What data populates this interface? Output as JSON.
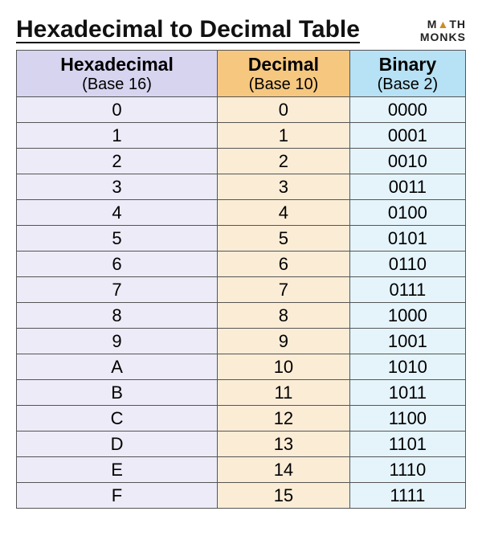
{
  "title": "Hexadecimal to Decimal Table",
  "logo": {
    "line1_pre": "M",
    "line1_tri": "▲",
    "line1_post": "TH",
    "line2": "MONKS"
  },
  "columns": [
    {
      "name": "Hexadecimal",
      "base": "(Base 16)"
    },
    {
      "name": "Decimal",
      "base": "(Base 10)"
    },
    {
      "name": "Binary",
      "base": "(Base 2)"
    }
  ],
  "rows": [
    {
      "hex": "0",
      "dec": "0",
      "bin": "0000"
    },
    {
      "hex": "1",
      "dec": "1",
      "bin": "0001"
    },
    {
      "hex": "2",
      "dec": "2",
      "bin": "0010"
    },
    {
      "hex": "3",
      "dec": "3",
      "bin": "0011"
    },
    {
      "hex": "4",
      "dec": "4",
      "bin": "0100"
    },
    {
      "hex": "5",
      "dec": "5",
      "bin": "0101"
    },
    {
      "hex": "6",
      "dec": "6",
      "bin": "0110"
    },
    {
      "hex": "7",
      "dec": "7",
      "bin": "0111"
    },
    {
      "hex": "8",
      "dec": "8",
      "bin": "1000"
    },
    {
      "hex": "9",
      "dec": "9",
      "bin": "1001"
    },
    {
      "hex": "A",
      "dec": "10",
      "bin": "1010"
    },
    {
      "hex": "B",
      "dec": "11",
      "bin": "1011"
    },
    {
      "hex": "C",
      "dec": "12",
      "bin": "1100"
    },
    {
      "hex": "D",
      "dec": "13",
      "bin": "1101"
    },
    {
      "hex": "E",
      "dec": "14",
      "bin": "1110"
    },
    {
      "hex": "F",
      "dec": "15",
      "bin": "1111"
    }
  ]
}
